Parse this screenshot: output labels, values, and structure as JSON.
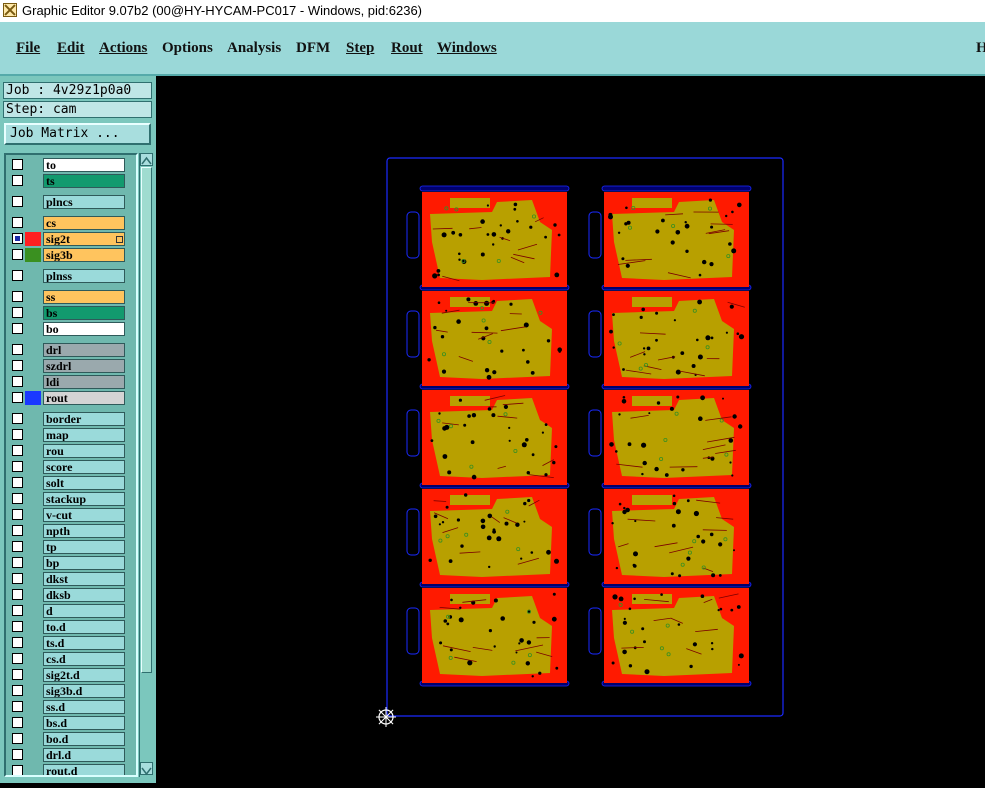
{
  "window": {
    "title": "Graphic Editor 9.07b2 (00@HY-HYCAM-PC017 - Windows, pid:6236)"
  },
  "menu": {
    "items": [
      "File",
      "Edit",
      "Actions",
      "Options",
      "Analysis",
      "DFM",
      "Step",
      "Rout",
      "Windows",
      "H"
    ]
  },
  "job": {
    "job_label": "Job : 4v29z1p0a0",
    "step_label": "Step: cam",
    "matrix_button": "Job Matrix ..."
  },
  "layers": [
    {
      "name": "to",
      "color": "#ffffff",
      "swatch": ""
    },
    {
      "name": "ts",
      "color": "#129a6e",
      "swatch": ""
    },
    {
      "name": "plncs",
      "color": "#9adada",
      "swatch": ""
    },
    {
      "name": "cs",
      "color": "#ffc45e",
      "swatch": ""
    },
    {
      "name": "sig2t",
      "color": "#ffc45e",
      "swatch": "#ff2020",
      "active": true
    },
    {
      "name": "sig3b",
      "color": "#ffc45e",
      "swatch": "#3a9020"
    },
    {
      "name": "plnss",
      "color": "#9adada",
      "swatch": ""
    },
    {
      "name": "ss",
      "color": "#ffc45e",
      "swatch": ""
    },
    {
      "name": "bs",
      "color": "#129a6e",
      "swatch": ""
    },
    {
      "name": "bo",
      "color": "#ffffff",
      "swatch": ""
    },
    {
      "name": "drl",
      "color": "#9aa9ad",
      "swatch": ""
    },
    {
      "name": "szdrl",
      "color": "#9aa9ad",
      "swatch": ""
    },
    {
      "name": "ldi",
      "color": "#9aa9ad",
      "swatch": ""
    },
    {
      "name": "rout",
      "color": "#d4d4d4",
      "swatch": "#1a38ff"
    },
    {
      "name": "border",
      "color": "#9adada",
      "swatch": ""
    },
    {
      "name": "map",
      "color": "#9adada",
      "swatch": ""
    },
    {
      "name": "rou",
      "color": "#9adada",
      "swatch": ""
    },
    {
      "name": "score",
      "color": "#9adada",
      "swatch": ""
    },
    {
      "name": "solt",
      "color": "#9adada",
      "swatch": ""
    },
    {
      "name": "stackup",
      "color": "#9adada",
      "swatch": ""
    },
    {
      "name": "v-cut",
      "color": "#9adada",
      "swatch": ""
    },
    {
      "name": "npth",
      "color": "#9adada",
      "swatch": ""
    },
    {
      "name": "tp",
      "color": "#9adada",
      "swatch": ""
    },
    {
      "name": "bp",
      "color": "#9adada",
      "swatch": ""
    },
    {
      "name": "dkst",
      "color": "#9adada",
      "swatch": ""
    },
    {
      "name": "dksb",
      "color": "#9adada",
      "swatch": ""
    },
    {
      "name": "d",
      "color": "#9adada",
      "swatch": ""
    },
    {
      "name": "to.d",
      "color": "#9adada",
      "swatch": ""
    },
    {
      "name": "ts.d",
      "color": "#9adada",
      "swatch": ""
    },
    {
      "name": "cs.d",
      "color": "#9adada",
      "swatch": ""
    },
    {
      "name": "sig2t.d",
      "color": "#9adada",
      "swatch": ""
    },
    {
      "name": "sig3b.d",
      "color": "#9adada",
      "swatch": ""
    },
    {
      "name": "ss.d",
      "color": "#9adada",
      "swatch": ""
    },
    {
      "name": "bs.d",
      "color": "#9adada",
      "swatch": ""
    },
    {
      "name": "bo.d",
      "color": "#9adada",
      "swatch": ""
    },
    {
      "name": "drl.d",
      "color": "#9adada",
      "swatch": ""
    },
    {
      "name": "rout.d",
      "color": "#9adada",
      "swatch": ""
    }
  ],
  "panel": {
    "board_rows": 5,
    "board_cols": 2
  },
  "colors": {
    "copper": "#ff1a00",
    "plane": "#b8a000",
    "outline": "#1a2aff",
    "rail": "#00006e",
    "background": "#000000"
  }
}
